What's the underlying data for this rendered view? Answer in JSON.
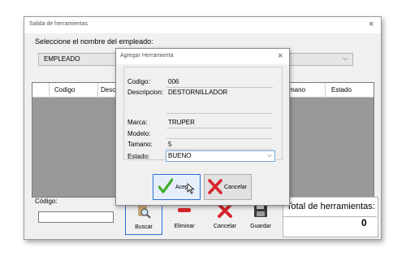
{
  "window": {
    "title": "Salida de herramientas",
    "close_glyph": "×"
  },
  "employee": {
    "label": "Seleccione el nombre del empleado:",
    "selected": "EMPLEADO"
  },
  "grid": {
    "columns": [
      "Codigo",
      "Descri",
      "mano",
      "Estado"
    ]
  },
  "codigo": {
    "label": "Código:",
    "value": ""
  },
  "toolbar": {
    "buscar": "Buscar",
    "eliminar": "Eliminar",
    "cancelar": "Cancelar",
    "guardar": "Guardar"
  },
  "total": {
    "label": "Total de herramientas:",
    "value": "0"
  },
  "dialog": {
    "title": "Agregar Herramienta",
    "close_glyph": "×",
    "codigo_label": "Codigo:",
    "codigo_value": "006",
    "descripcion_label": "Descripcion:",
    "descripcion_value": "DESTORNILLADOR",
    "marca_label": "Marca:",
    "marca_value": "TRUPER",
    "modelo_label": "Modelo:",
    "modelo_value": "",
    "tamano_label": "Tamano:",
    "tamano_value": "5",
    "estado_label": "Estado:",
    "estado_value": "BUENO",
    "accept_label": "Acep",
    "cancel_label": "Cancelar"
  },
  "colors": {
    "accent_blue": "#2b6fd8",
    "check_green": "#3fae2a",
    "cross_red": "#d8262b"
  }
}
